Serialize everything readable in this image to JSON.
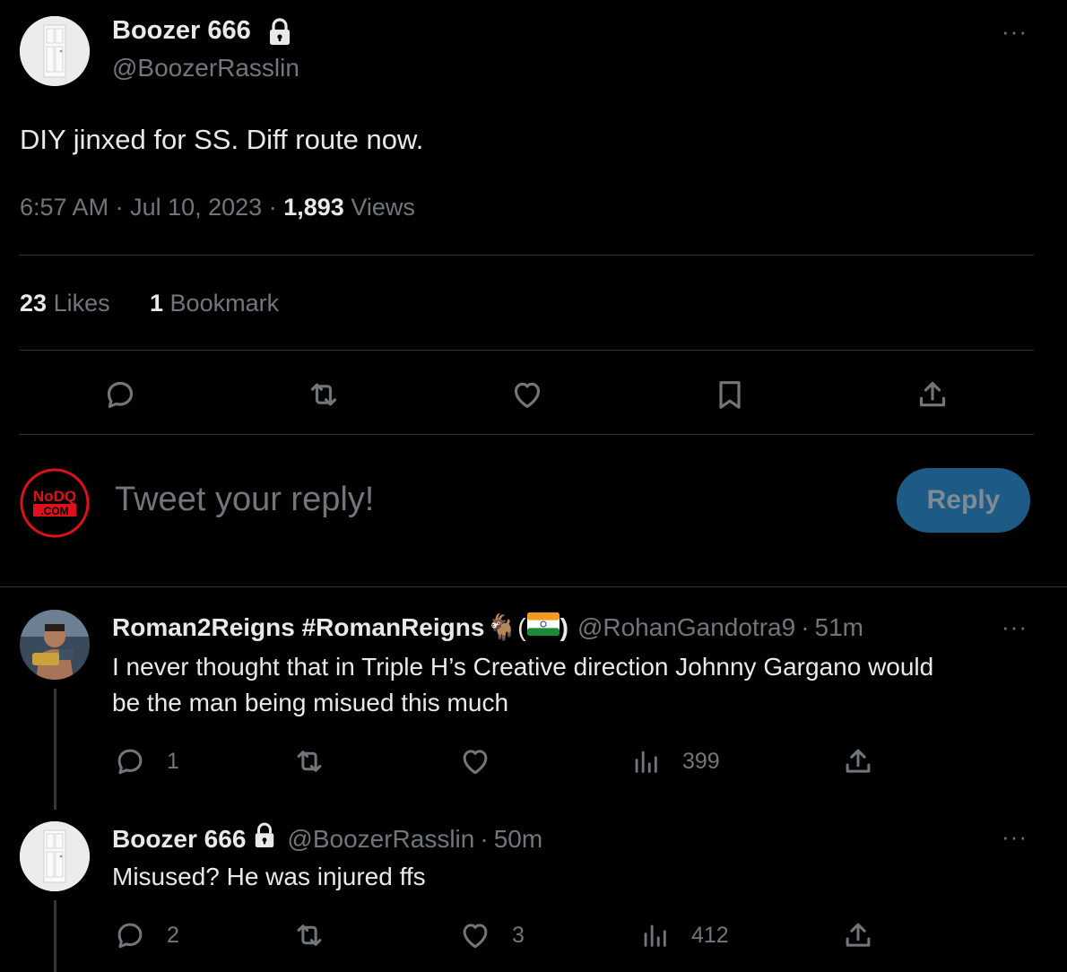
{
  "tweet": {
    "author_name": "Boozer 666",
    "handle": "@BoozerRasslin",
    "text": "DIY jinxed for SS. Diff route now.",
    "time": "6:57 AM",
    "date": "Jul 10, 2023",
    "views_count": "1,893",
    "views_label": "Views",
    "likes_count": "23",
    "likes_label": "Likes",
    "bookmarks_count": "1",
    "bookmarks_label": "Bookmark",
    "more": "···"
  },
  "composer": {
    "placeholder": "Tweet your reply!",
    "reply_button": "Reply",
    "avatar_text": "NoDQ.COM"
  },
  "replies": [
    {
      "author_name": "Roman2Reigns #RomanReigns",
      "emoji": "🐐(",
      "flag_suffix": ")",
      "handle": "@RohanGandotra9",
      "time": "51m",
      "text_line1": "I never thought that in Triple H’s Creative direction Johnny Gargano would",
      "text_line2": "be the man being misued this much",
      "reply_count": "1",
      "retweet_count": "",
      "like_count": "",
      "views": "399",
      "more": "···"
    },
    {
      "author_name": "Boozer 666",
      "handle": "@BoozerRasslin",
      "time": "50m",
      "text_line1": "Misused? He was injured ffs",
      "reply_count": "2",
      "retweet_count": "",
      "like_count": "3",
      "views": "412",
      "more": "···"
    }
  ],
  "colors": {
    "background": "#000000",
    "text": "#e7e9ea",
    "muted": "#71767b",
    "divider": "#2f3336",
    "reply_button": "#1d5b86"
  }
}
